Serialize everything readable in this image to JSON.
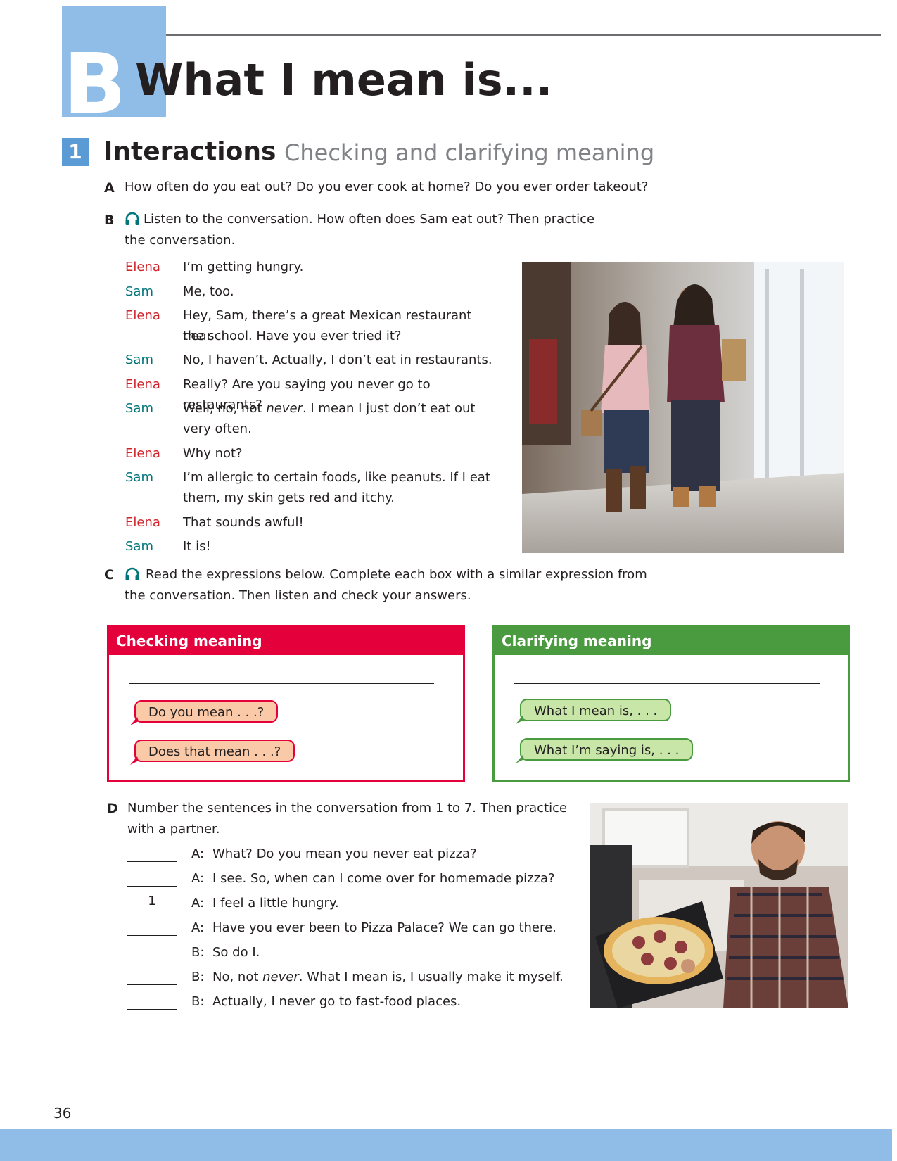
{
  "unit": {
    "letter": "B",
    "title": "What I mean is..."
  },
  "section": {
    "number": "1",
    "title": "Interactions",
    "subtitle": "Checking and clarifying meaning"
  },
  "task_a": {
    "letter": "A",
    "text": "How often do you eat out? Do you ever cook at home? Do you ever order takeout?"
  },
  "task_b": {
    "letter": "B",
    "text_line1": "Listen to the conversation. How often does Sam eat out? Then practice",
    "text_line2": "the conversation."
  },
  "conversation": [
    {
      "speaker": "Elena",
      "line1": "I’m getting hungry.",
      "line2": ""
    },
    {
      "speaker": "Sam",
      "line1": "Me, too.",
      "line2": ""
    },
    {
      "speaker": "Elena",
      "line1": "Hey, Sam, there’s a great Mexican restaurant near",
      "line2": "the school. Have you ever tried it?"
    },
    {
      "speaker": "Sam",
      "line1": "No, I haven’t. Actually, I don’t eat in restaurants.",
      "line2": ""
    },
    {
      "speaker": "Elena",
      "line1": "Really? Are you saying you never go to restaurants?",
      "line2": ""
    },
    {
      "speaker": "Sam",
      "line1_pre": "Well, no, not ",
      "line1_em": "never",
      "line1_post": ". I mean I just don’t eat out",
      "line2": "very often."
    },
    {
      "speaker": "Elena",
      "line1": "Why not?",
      "line2": ""
    },
    {
      "speaker": "Sam",
      "line1": "I’m allergic to certain foods, like peanuts. If I eat",
      "line2": "them, my skin gets red and itchy."
    },
    {
      "speaker": "Elena",
      "line1": "That sounds awful!",
      "line2": ""
    },
    {
      "speaker": "Sam",
      "line1": "It is!",
      "line2": ""
    }
  ],
  "task_c": {
    "letter": "C",
    "text_line1": "Read the expressions below. Complete each box with a similar expression from",
    "text_line2": "the conversation. Then listen and check your answers."
  },
  "box_checking": {
    "title": "Checking meaning",
    "expressions": [
      "Do you mean . . .?",
      "Does that mean . . .?"
    ]
  },
  "box_clarifying": {
    "title": "Clarifying meaning",
    "expressions": [
      "What I mean is, . . .",
      "What I’m saying is, . . ."
    ]
  },
  "task_d": {
    "letter": "D",
    "text_line1": "Number the sentences in the conversation from 1 to 7. Then practice",
    "text_line2": "with a partner."
  },
  "ordering": [
    {
      "answer": "",
      "speaker": "A:",
      "text": "What? Do you mean you never eat pizza?"
    },
    {
      "answer": "",
      "speaker": "A:",
      "text": "I see. So, when can I come over for homemade pizza?"
    },
    {
      "answer": "1",
      "speaker": "A:",
      "text": "I feel a little hungry."
    },
    {
      "answer": "",
      "speaker": "A:",
      "text": "Have you ever been to Pizza Palace? We can go there."
    },
    {
      "answer": "",
      "speaker": "B:",
      "text": "So do I."
    },
    {
      "answer": "",
      "speaker": "B:",
      "text_pre": "No, not ",
      "text_em": "never",
      "text_post": ". What I mean is, I usually make it myself."
    },
    {
      "answer": "",
      "speaker": "B:",
      "text": "Actually, I never go to fast-food places."
    }
  ],
  "page_number": "36",
  "colors": {
    "accent_blue": "#8fbde8",
    "elena_red": "#d2232a",
    "sam_teal": "#00757a",
    "checking_red": "#e4003b",
    "clarifying_green": "#4a9a3f"
  }
}
